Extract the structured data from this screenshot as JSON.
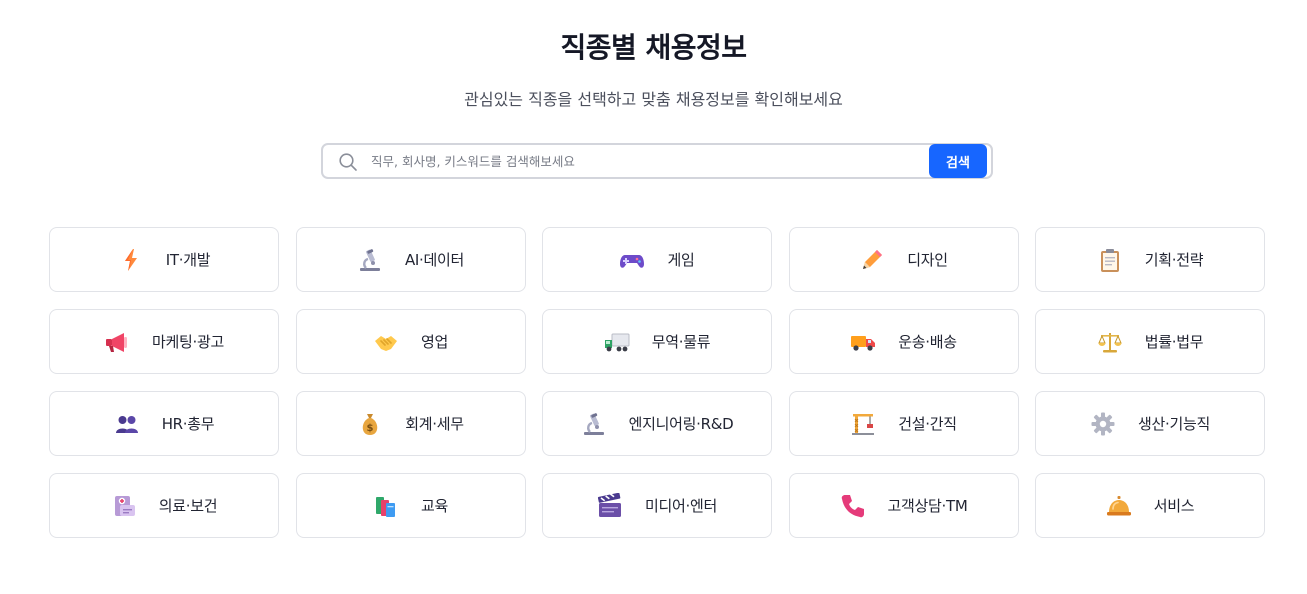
{
  "header": {
    "title": "직종별 채용정보",
    "subtitle": "관심있는 직종을 선택하고 맞춤 채용정보를 확인해보세요"
  },
  "search": {
    "placeholder": "직무, 회사명, 키스워드를 검색해보세요",
    "value": "",
    "button_label": "검색"
  },
  "colors": {
    "accent": "#1766ff",
    "card_border": "#e1e3e8",
    "search_border": "#d3d5dc"
  },
  "categories": [
    {
      "label": "IT·개발",
      "icon": "lightning-icon"
    },
    {
      "label": "AI·데이터",
      "icon": "microscope-icon"
    },
    {
      "label": "게임",
      "icon": "gamepad-icon"
    },
    {
      "label": "디자인",
      "icon": "pencil-icon"
    },
    {
      "label": "기획·전략",
      "icon": "clipboard-icon"
    },
    {
      "label": "마케팅·광고",
      "icon": "megaphone-icon"
    },
    {
      "label": "영업",
      "icon": "handshake-icon"
    },
    {
      "label": "무역·물류",
      "icon": "truck-icon"
    },
    {
      "label": "운송·배송",
      "icon": "delivery-truck-icon"
    },
    {
      "label": "법률·법무",
      "icon": "scales-icon"
    },
    {
      "label": "HR·총무",
      "icon": "people-icon"
    },
    {
      "label": "회계·세무",
      "icon": "money-bag-icon"
    },
    {
      "label": "엔지니어링·R&D",
      "icon": "microscope-icon"
    },
    {
      "label": "건설·간직",
      "icon": "crane-icon"
    },
    {
      "label": "생산·기능직",
      "icon": "gear-icon"
    },
    {
      "label": "의료·보건",
      "icon": "medical-kit-icon"
    },
    {
      "label": "교육",
      "icon": "books-icon"
    },
    {
      "label": "미디어·엔터",
      "icon": "clapper-board-icon"
    },
    {
      "label": "고객상담·TM",
      "icon": "phone-icon"
    },
    {
      "label": "서비스",
      "icon": "service-bell-icon"
    }
  ]
}
